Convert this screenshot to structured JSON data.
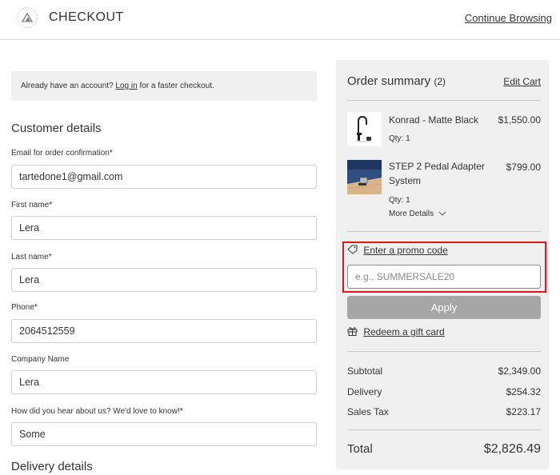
{
  "header": {
    "brand_logo_alt": "Principle Faucets",
    "title": "CHECKOUT",
    "continue_browsing": "Continue Browsing"
  },
  "login_prompt": {
    "prefix": "Already have an account? ",
    "link": "Log in",
    "suffix": " for a faster checkout."
  },
  "customer_details": {
    "title": "Customer details",
    "fields": [
      {
        "label": "Email for order confirmation*",
        "value": "tartedone1@gmail.com"
      },
      {
        "label": "First name*",
        "value": "Lera"
      },
      {
        "label": "Last name*",
        "value": "Lera"
      },
      {
        "label": "Phone*",
        "value": "2064512559"
      },
      {
        "label": "Company Name",
        "value": "Lera"
      },
      {
        "label": "How did you hear about us? We'd love to know!*",
        "value": "Some"
      }
    ]
  },
  "delivery_details": {
    "title": "Delivery details"
  },
  "order_summary": {
    "title": "Order summary",
    "count": "(2)",
    "edit_cart": "Edit Cart",
    "items": [
      {
        "name": "Konrad - Matte Black",
        "price": "$1,550.00",
        "qty": "Qty: 1",
        "thumb_icon": "faucet-image"
      },
      {
        "name": "STEP 2 Pedal Adapter System",
        "price": "$799.00",
        "qty": "Qty: 1",
        "more_details": "More Details",
        "thumb_icon": "pedal-adapter-image"
      }
    ],
    "promo": {
      "link": "Enter a promo code",
      "placeholder": "e.g., SUMMERSALE20",
      "value": "",
      "apply": "Apply",
      "highlight_color": "#e0141e"
    },
    "gift_card": "Redeem a gift card",
    "totals": [
      {
        "label": "Subtotal",
        "value": "$2,349.00"
      },
      {
        "label": "Delivery",
        "value": "$254.32"
      },
      {
        "label": "Sales Tax",
        "value": "$223.17"
      }
    ],
    "total": {
      "label": "Total",
      "value": "$2,826.49"
    }
  }
}
